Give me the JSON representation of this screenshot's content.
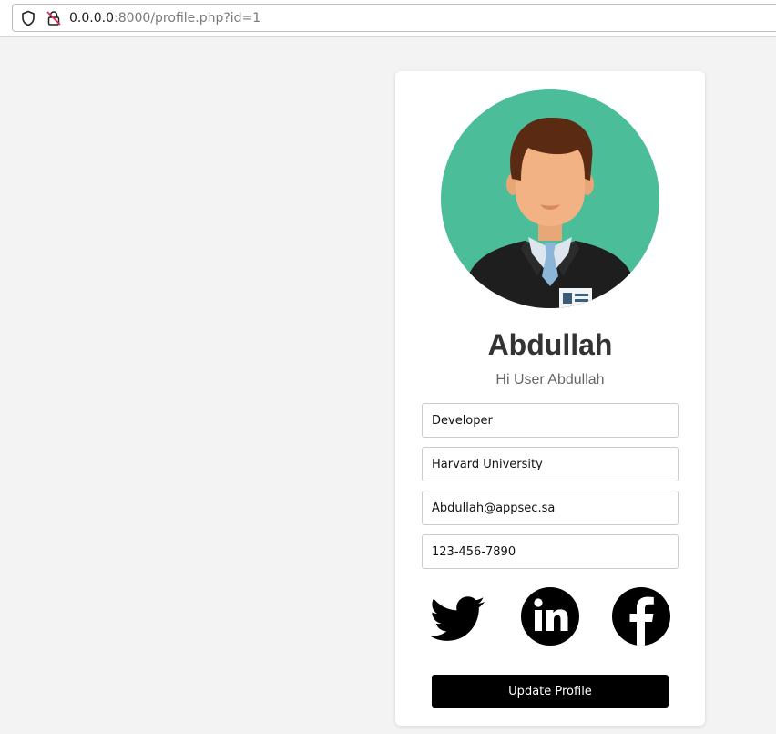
{
  "browser": {
    "url_host": "0.0.0.0",
    "url_rest": ":8000/profile.php?id=1"
  },
  "profile": {
    "name": "Abdullah",
    "greeting": "Hi User Abdullah",
    "fields": {
      "job": "Developer",
      "university": "Harvard University",
      "email": "Abdullah@appsec.sa",
      "phone": "123-456-7890"
    },
    "social": [
      "twitter-icon",
      "linkedin-icon",
      "facebook-icon"
    ],
    "update_label": "Update Profile"
  },
  "colors": {
    "page_bg": "#f3f3f3",
    "avatar_bg": "#4bbd98",
    "button_bg": "#000000",
    "name_text": "#333333"
  }
}
